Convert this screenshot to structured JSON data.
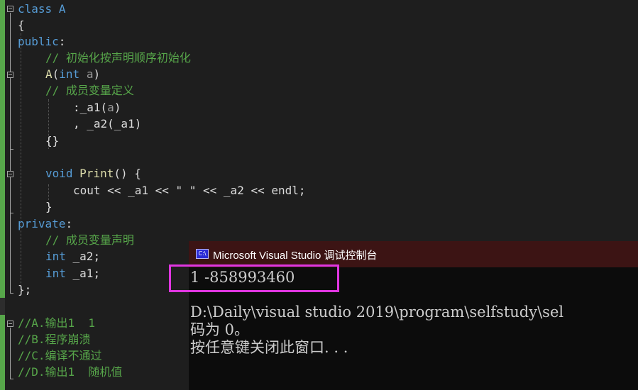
{
  "code": {
    "line1_kw": "class",
    "line1_name": "A",
    "line2": "{",
    "line3_kw": "public",
    "line3_punc": ":",
    "line4_comment": "// 初始化按声明顺序初始化",
    "line5_fn": "A",
    "line5_open": "(",
    "line5_type": "int",
    "line5_param": "a",
    "line5_close": ")",
    "line6_comment": "// 成员变量定义",
    "line7_a": ":_a1(",
    "line7_param": "a",
    "line7_b": ")",
    "line8": ", _a2(_a1)",
    "line9": "{}",
    "line11_type": "void",
    "line11_fn": "Print",
    "line11_rest": "() {",
    "line12": "cout << _a1 << \" \" << _a2 << endl;",
    "line13": "}",
    "line14_kw": "private",
    "line14_punc": ":",
    "line15_comment": "// 成员变量声明",
    "line16_type": "int",
    "line16_rest": " _a2;",
    "line17_type": "int",
    "line17_rest": " _a1;",
    "line18": "};",
    "opt_a": "//A.输出1  1",
    "opt_b": "//B.程序崩溃",
    "opt_c": "//C.编译不通过",
    "opt_d": "//D.输出1  随机值"
  },
  "console": {
    "icon": "C:\\",
    "title": "Microsoft Visual Studio 调试控制台",
    "output_line1": "1 -858993460",
    "output_line2": "D:\\Daily\\visual studio 2019\\program\\selfstudy\\sel",
    "output_line3": "码为 0。",
    "output_line4": "按任意键关闭此窗口. . ."
  }
}
